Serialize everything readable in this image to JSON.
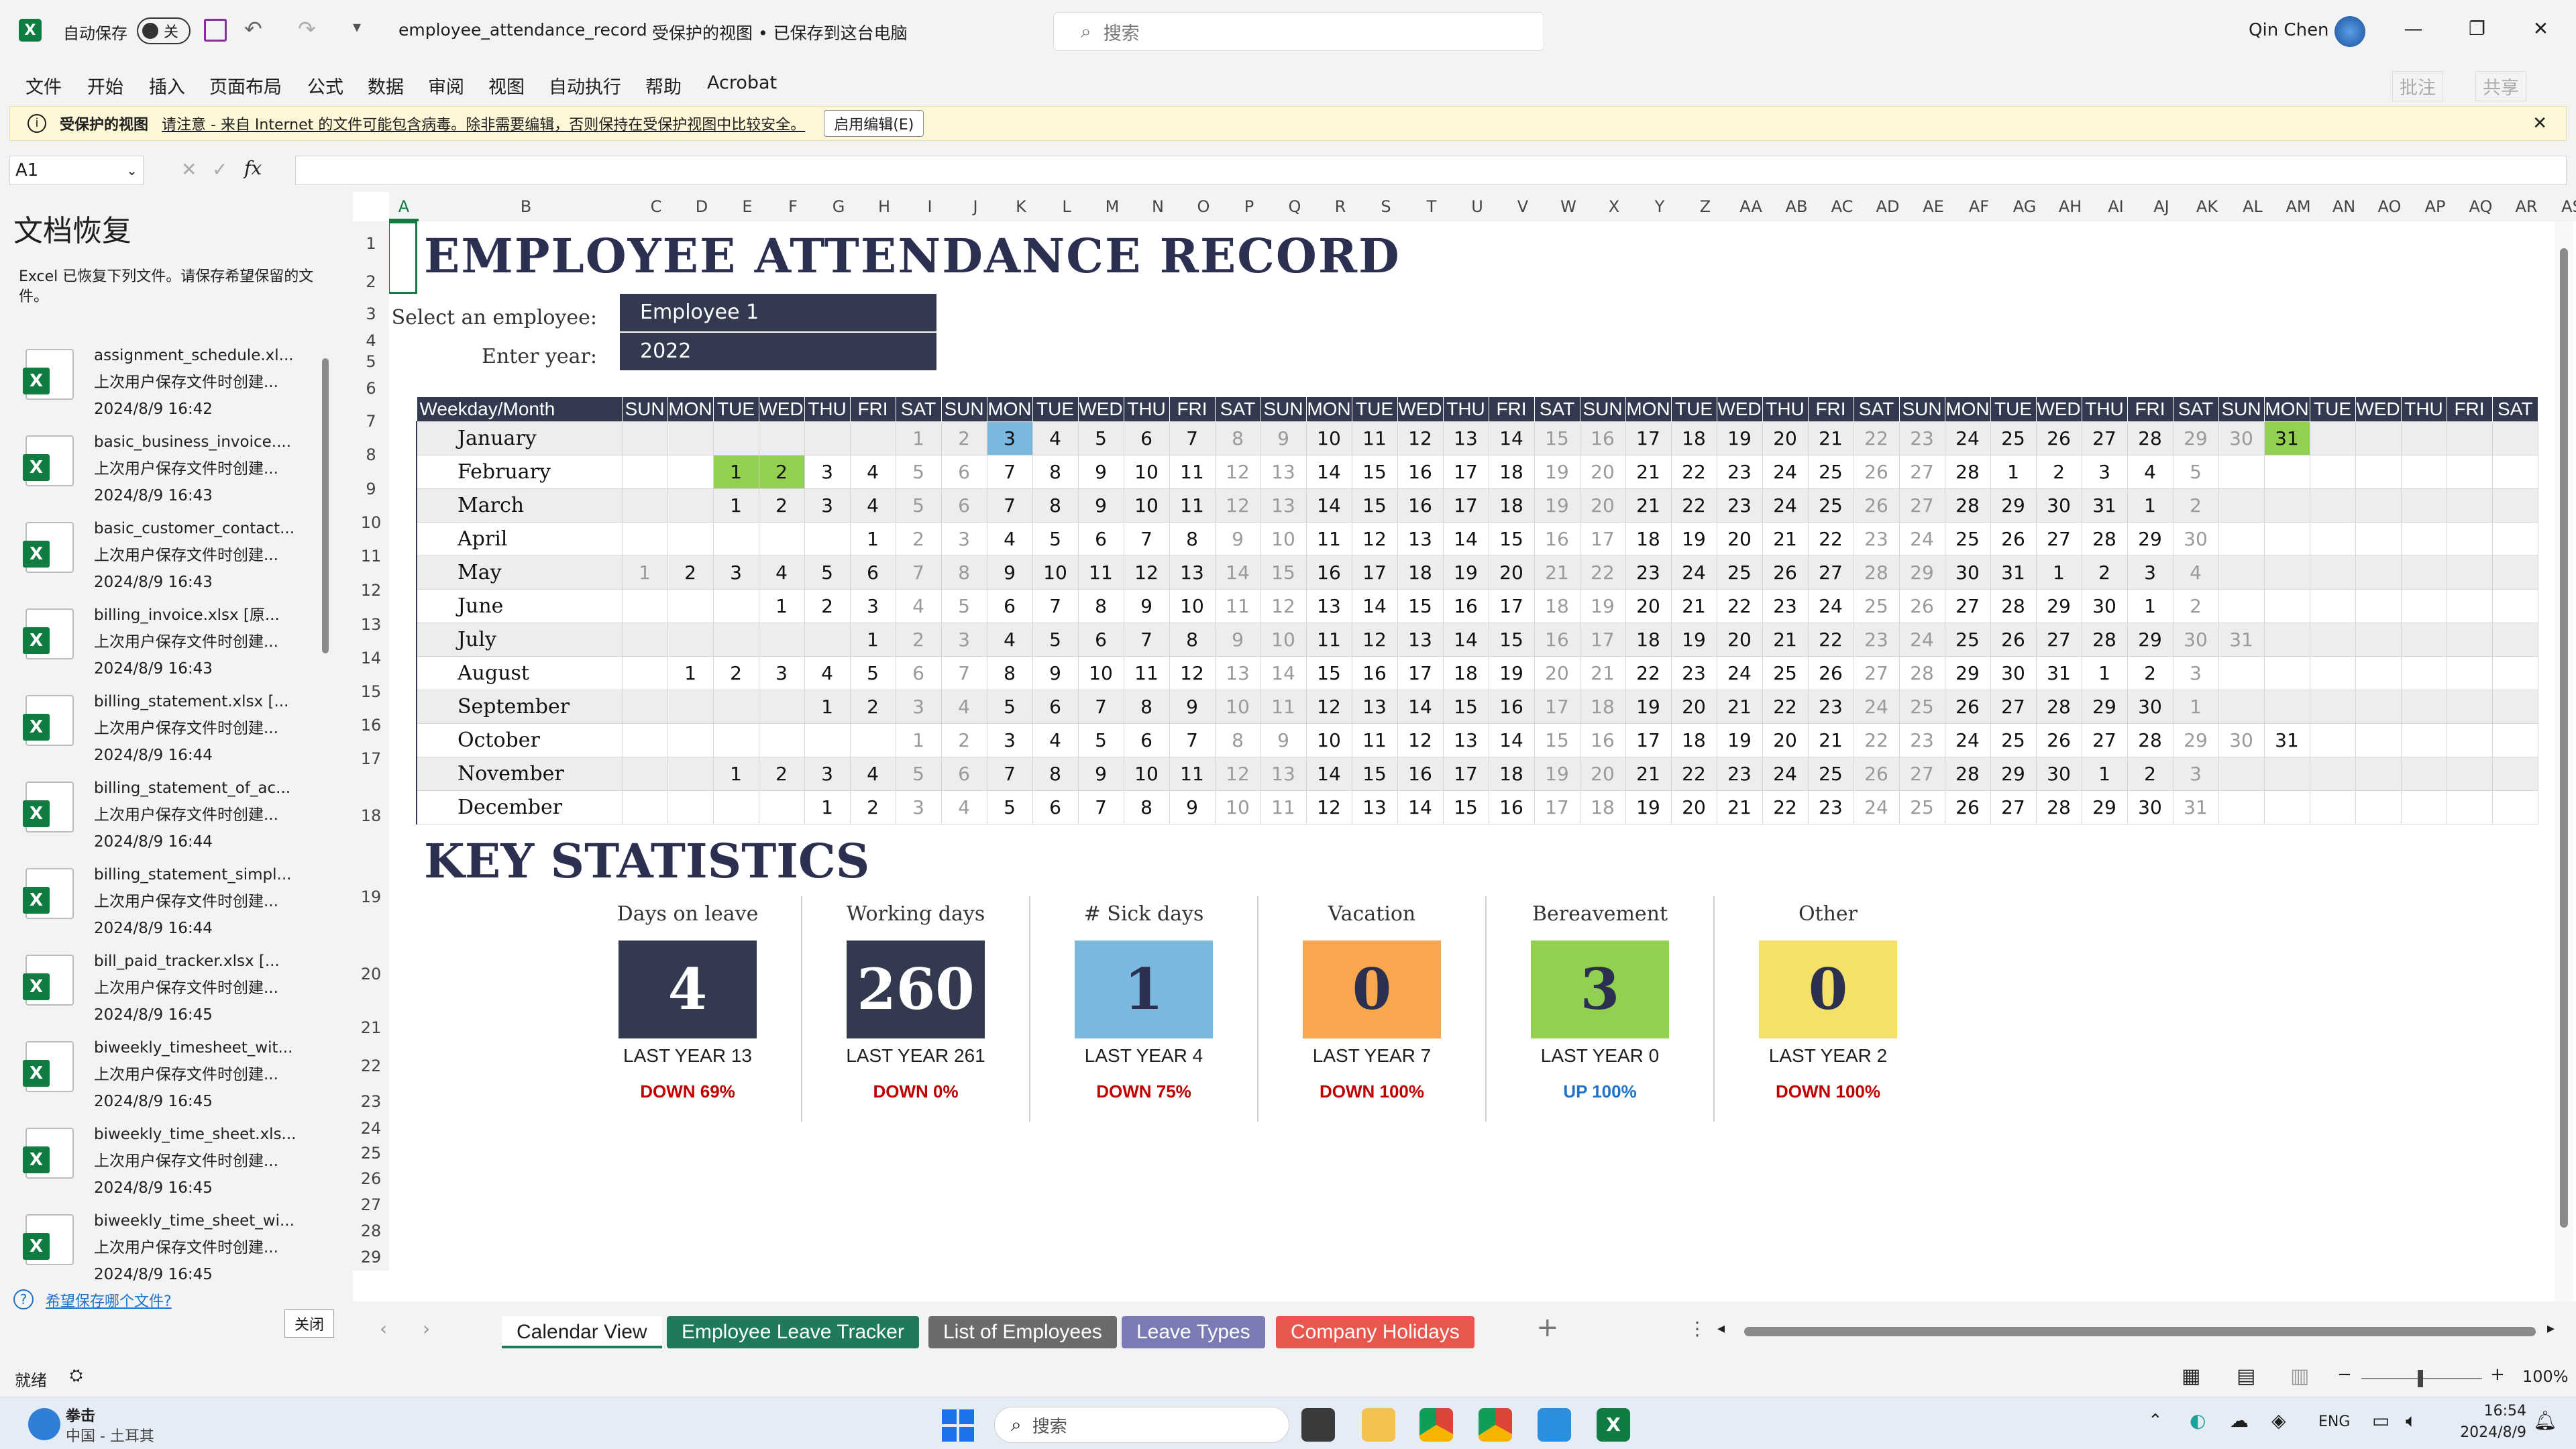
{
  "titlebar": {
    "autosave_label": "自动保存",
    "autosave_state": "关",
    "filename": "employee_attendance_record",
    "status": "受保护的视图 • 已保存到这台电脑",
    "search_placeholder": "搜索",
    "user": "Qin Chen"
  },
  "menu": [
    "文件",
    "开始",
    "插入",
    "页面布局",
    "公式",
    "数据",
    "审阅",
    "视图",
    "自动执行",
    "帮助",
    "Acrobat"
  ],
  "ribbon_right": {
    "comments": "批注",
    "share": "共享"
  },
  "protected": {
    "label": "受保护的视图",
    "message": "请注意 - 来自 Internet 的文件可能包含病毒。除非需要编辑，否则保持在受保护视图中比较安全。",
    "button": "启用编辑(E)"
  },
  "formula": {
    "namebox": "A1",
    "fx": "fx"
  },
  "recovery": {
    "title": "文档恢复",
    "desc": "Excel 已恢复下列文件。请保存希望保留的文件。",
    "items": [
      {
        "name": "assignment_schedule.xl...",
        "sub": "上次用户保存文件时创建...",
        "time": "2024/8/9 16:42"
      },
      {
        "name": "basic_business_invoice....",
        "sub": "上次用户保存文件时创建...",
        "time": "2024/8/9 16:43"
      },
      {
        "name": "basic_customer_contact...",
        "sub": "上次用户保存文件时创建...",
        "time": "2024/8/9 16:43"
      },
      {
        "name": "billing_invoice.xlsx  [原...",
        "sub": "上次用户保存文件时创建...",
        "time": "2024/8/9 16:43"
      },
      {
        "name": "billing_statement.xlsx  [...",
        "sub": "上次用户保存文件时创建...",
        "time": "2024/8/9 16:44"
      },
      {
        "name": "billing_statement_of_ac...",
        "sub": "上次用户保存文件时创建...",
        "time": "2024/8/9 16:44"
      },
      {
        "name": "billing_statement_simpl...",
        "sub": "上次用户保存文件时创建...",
        "time": "2024/8/9 16:44"
      },
      {
        "name": "bill_paid_tracker.xlsx  [...",
        "sub": "上次用户保存文件时创建...",
        "time": "2024/8/9 16:45"
      },
      {
        "name": "biweekly_timesheet_wit...",
        "sub": "上次用户保存文件时创建...",
        "time": "2024/8/9 16:45"
      },
      {
        "name": "biweekly_time_sheet.xls...",
        "sub": "上次用户保存文件时创建...",
        "time": "2024/8/9 16:45"
      },
      {
        "name": "biweekly_time_sheet_wi...",
        "sub": "上次用户保存文件时创建...",
        "time": "2024/8/9 16:45"
      }
    ],
    "link": "希望保存哪个文件?",
    "close": "关闭"
  },
  "columns": [
    "A",
    "B",
    "C",
    "D",
    "E",
    "F",
    "G",
    "H",
    "I",
    "J",
    "K",
    "L",
    "M",
    "N",
    "O",
    "P",
    "Q",
    "R",
    "S",
    "T",
    "U",
    "V",
    "W",
    "X",
    "Y",
    "Z",
    "AA",
    "AB",
    "AC",
    "AD",
    "AE",
    "AF",
    "AG",
    "AH",
    "AI",
    "AJ",
    "AK",
    "AL",
    "AM",
    "AN",
    "AO",
    "AP",
    "AQ",
    "AR",
    "AS"
  ],
  "rows": [
    "1",
    "2",
    "3",
    "4",
    "5",
    "6",
    "7",
    "8",
    "9",
    "10",
    "11",
    "12",
    "13",
    "14",
    "15",
    "16",
    "17",
    "18",
    "19",
    "20",
    "21",
    "22",
    "23",
    "24",
    "25",
    "26",
    "27",
    "28",
    "29"
  ],
  "sheet": {
    "title": "EMPLOYEE ATTENDANCE RECORD",
    "employee_label": "Select an employee:",
    "employee_value": "Employee 1",
    "year_label": "Enter year:",
    "year_value": "2022",
    "header_first": "Weekday/Month",
    "weekdays": [
      "SUN",
      "MON",
      "TUE",
      "WED",
      "THU",
      "FRI",
      "SAT",
      "SUN",
      "MON",
      "TUE",
      "WED",
      "THU",
      "FRI",
      "SAT",
      "SUN",
      "MON",
      "TUE",
      "WED",
      "THU",
      "FRI",
      "SAT",
      "SUN",
      "MON",
      "TUE",
      "WED",
      "THU",
      "FRI",
      "SAT",
      "SUN",
      "MON",
      "TUE",
      "WED",
      "THU",
      "FRI",
      "SAT",
      "SUN",
      "MON",
      "TUE",
      "WED",
      "THU",
      "FRI",
      "SAT"
    ],
    "months": [
      {
        "name": "January",
        "cells": [
          "",
          "",
          "",
          "",
          "",
          "",
          "1",
          "2",
          "3",
          "4",
          "5",
          "6",
          "7",
          "8",
          "9",
          "10",
          "11",
          "12",
          "13",
          "14",
          "15",
          "16",
          "17",
          "18",
          "19",
          "20",
          "21",
          "22",
          "23",
          "24",
          "25",
          "26",
          "27",
          "28",
          "29",
          "30",
          "31",
          "",
          "",
          "",
          "",
          ""
        ]
      },
      {
        "name": "February",
        "cells": [
          "",
          "",
          "1",
          "2",
          "3",
          "4",
          "5",
          "6",
          "7",
          "8",
          "9",
          "10",
          "11",
          "12",
          "13",
          "14",
          "15",
          "16",
          "17",
          "18",
          "19",
          "20",
          "21",
          "22",
          "23",
          "24",
          "25",
          "26",
          "27",
          "28",
          "1",
          "2",
          "3",
          "4",
          "5",
          "",
          "",
          "",
          "",
          "",
          "",
          ""
        ]
      },
      {
        "name": "March",
        "cells": [
          "",
          "",
          "1",
          "2",
          "3",
          "4",
          "5",
          "6",
          "7",
          "8",
          "9",
          "10",
          "11",
          "12",
          "13",
          "14",
          "15",
          "16",
          "17",
          "18",
          "19",
          "20",
          "21",
          "22",
          "23",
          "24",
          "25",
          "26",
          "27",
          "28",
          "29",
          "30",
          "31",
          "1",
          "2",
          "",
          "",
          "",
          "",
          "",
          "",
          ""
        ]
      },
      {
        "name": "April",
        "cells": [
          "",
          "",
          "",
          "",
          "",
          "1",
          "2",
          "3",
          "4",
          "5",
          "6",
          "7",
          "8",
          "9",
          "10",
          "11",
          "12",
          "13",
          "14",
          "15",
          "16",
          "17",
          "18",
          "19",
          "20",
          "21",
          "22",
          "23",
          "24",
          "25",
          "26",
          "27",
          "28",
          "29",
          "30",
          "",
          "",
          "",
          "",
          "",
          "",
          ""
        ]
      },
      {
        "name": "May",
        "cells": [
          "1",
          "2",
          "3",
          "4",
          "5",
          "6",
          "7",
          "8",
          "9",
          "10",
          "11",
          "12",
          "13",
          "14",
          "15",
          "16",
          "17",
          "18",
          "19",
          "20",
          "21",
          "22",
          "23",
          "24",
          "25",
          "26",
          "27",
          "28",
          "29",
          "30",
          "31",
          "1",
          "2",
          "3",
          "4",
          "",
          "",
          "",
          "",
          "",
          "",
          ""
        ]
      },
      {
        "name": "June",
        "cells": [
          "",
          "",
          "",
          "1",
          "2",
          "3",
          "4",
          "5",
          "6",
          "7",
          "8",
          "9",
          "10",
          "11",
          "12",
          "13",
          "14",
          "15",
          "16",
          "17",
          "18",
          "19",
          "20",
          "21",
          "22",
          "23",
          "24",
          "25",
          "26",
          "27",
          "28",
          "29",
          "30",
          "1",
          "2",
          "",
          "",
          "",
          "",
          "",
          "",
          ""
        ]
      },
      {
        "name": "July",
        "cells": [
          "",
          "",
          "",
          "",
          "",
          "1",
          "2",
          "3",
          "4",
          "5",
          "6",
          "7",
          "8",
          "9",
          "10",
          "11",
          "12",
          "13",
          "14",
          "15",
          "16",
          "17",
          "18",
          "19",
          "20",
          "21",
          "22",
          "23",
          "24",
          "25",
          "26",
          "27",
          "28",
          "29",
          "30",
          "31",
          "",
          "",
          "",
          "",
          "",
          ""
        ]
      },
      {
        "name": "August",
        "cells": [
          "",
          "1",
          "2",
          "3",
          "4",
          "5",
          "6",
          "7",
          "8",
          "9",
          "10",
          "11",
          "12",
          "13",
          "14",
          "15",
          "16",
          "17",
          "18",
          "19",
          "20",
          "21",
          "22",
          "23",
          "24",
          "25",
          "26",
          "27",
          "28",
          "29",
          "30",
          "31",
          "1",
          "2",
          "3",
          "",
          "",
          "",
          "",
          "",
          "",
          ""
        ]
      },
      {
        "name": "September",
        "cells": [
          "",
          "",
          "",
          "",
          "1",
          "2",
          "3",
          "4",
          "5",
          "6",
          "7",
          "8",
          "9",
          "10",
          "11",
          "12",
          "13",
          "14",
          "15",
          "16",
          "17",
          "18",
          "19",
          "20",
          "21",
          "22",
          "23",
          "24",
          "25",
          "26",
          "27",
          "28",
          "29",
          "30",
          "1",
          "",
          "",
          "",
          "",
          "",
          "",
          ""
        ]
      },
      {
        "name": "October",
        "cells": [
          "",
          "",
          "",
          "",
          "",
          "",
          "1",
          "2",
          "3",
          "4",
          "5",
          "6",
          "7",
          "8",
          "9",
          "10",
          "11",
          "12",
          "13",
          "14",
          "15",
          "16",
          "17",
          "18",
          "19",
          "20",
          "21",
          "22",
          "23",
          "24",
          "25",
          "26",
          "27",
          "28",
          "29",
          "30",
          "31",
          "",
          "",
          "",
          "",
          ""
        ]
      },
      {
        "name": "November",
        "cells": [
          "",
          "",
          "1",
          "2",
          "3",
          "4",
          "5",
          "6",
          "7",
          "8",
          "9",
          "10",
          "11",
          "12",
          "13",
          "14",
          "15",
          "16",
          "17",
          "18",
          "19",
          "20",
          "21",
          "22",
          "23",
          "24",
          "25",
          "26",
          "27",
          "28",
          "29",
          "30",
          "1",
          "2",
          "3",
          "",
          "",
          "",
          "",
          "",
          "",
          ""
        ]
      },
      {
        "name": "December",
        "cells": [
          "",
          "",
          "",
          "",
          "1",
          "2",
          "3",
          "4",
          "5",
          "6",
          "7",
          "8",
          "9",
          "10",
          "11",
          "12",
          "13",
          "14",
          "15",
          "16",
          "17",
          "18",
          "19",
          "20",
          "21",
          "22",
          "23",
          "24",
          "25",
          "26",
          "27",
          "28",
          "29",
          "30",
          "31",
          "",
          "",
          "",
          "",
          "",
          "",
          ""
        ]
      }
    ],
    "stats_title": "KEY STATISTICS",
    "stats": [
      {
        "label": "Days on leave",
        "value": "4",
        "last": "LAST YEAR  13",
        "change": "DOWN 69%",
        "color": "#333a4f",
        "text": "#ffffff",
        "change_color": "#c00000"
      },
      {
        "label": "Working days",
        "value": "260",
        "last": "LAST YEAR  261",
        "change": "DOWN 0%",
        "color": "#333a4f",
        "text": "#ffffff",
        "change_color": "#c00000"
      },
      {
        "label": "# Sick days",
        "value": "1",
        "last": "LAST YEAR  4",
        "change": "DOWN 75%",
        "color": "#7cb7de",
        "text": "#2b3050",
        "change_color": "#c00000"
      },
      {
        "label": "Vacation",
        "value": "0",
        "last": "LAST YEAR  7",
        "change": "DOWN 100%",
        "color": "#f8a74f",
        "text": "#2b3050",
        "change_color": "#c00000"
      },
      {
        "label": "Bereavement",
        "value": "3",
        "last": "LAST YEAR  0",
        "change": "UP 100%",
        "color": "#92d050",
        "text": "#2b3050",
        "change_color": "#1f73c9"
      },
      {
        "label": "Other",
        "value": "0",
        "last": "LAST YEAR  2",
        "change": "DOWN 100%",
        "color": "#f5e06a",
        "text": "#2b3050",
        "change_color": "#c00000"
      }
    ]
  },
  "tabs": [
    {
      "label": "Calendar View",
      "bg": "#ffffff",
      "fg": "#1f1f1f",
      "active": true
    },
    {
      "label": "Employee Leave Tracker",
      "bg": "#1f7a5a",
      "fg": "#ffffff"
    },
    {
      "label": "List of Employees",
      "bg": "#6b6b6b",
      "fg": "#ffffff"
    },
    {
      "label": "Leave Types",
      "bg": "#7a7ab4",
      "fg": "#ffffff"
    },
    {
      "label": "Company Holidays",
      "bg": "#e8574e",
      "fg": "#ffffff"
    }
  ],
  "status": {
    "ready": "就绪",
    "zoom": "100%"
  },
  "taskbar": {
    "weather_title": "拳击",
    "weather_sub": "中国 - 土耳其",
    "search": "搜索",
    "lang": "ENG",
    "time": "16:54",
    "date": "2024/8/9"
  }
}
